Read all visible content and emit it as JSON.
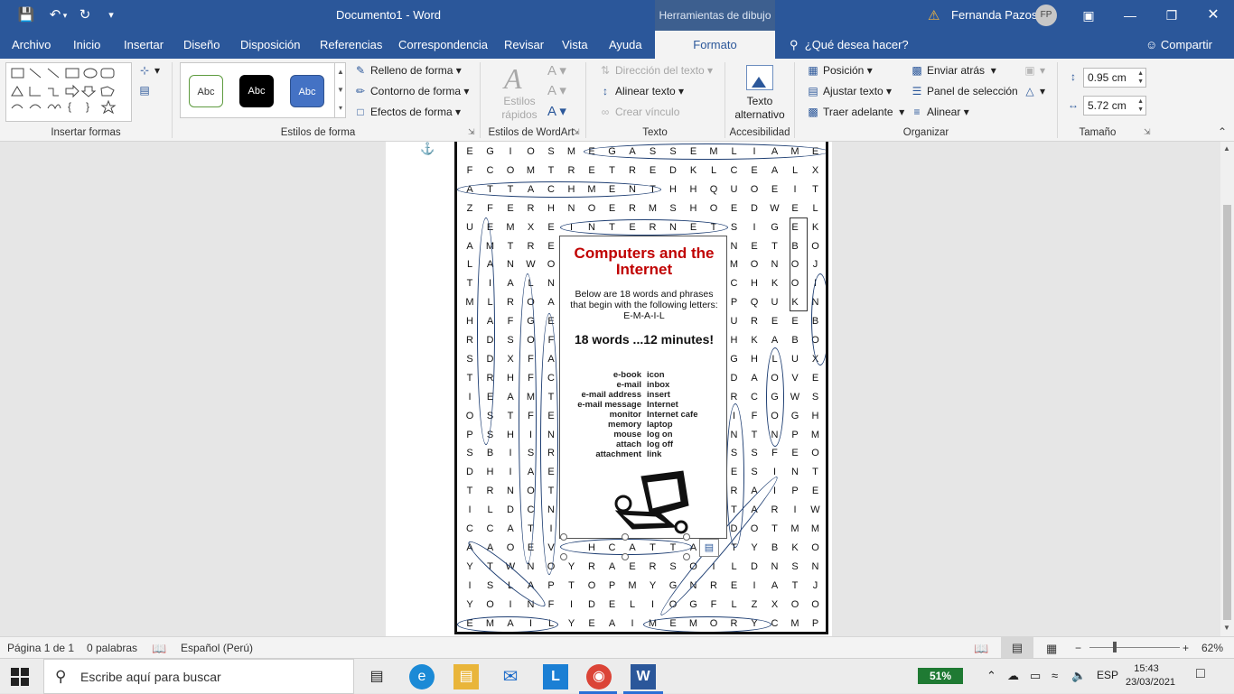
{
  "titlebar": {
    "doc_title": "Documento1  -  Word",
    "drawing_tools": "Herramientas de dibujo",
    "user_name": "Fernanda Pazos",
    "user_initials": "FP"
  },
  "tabs": [
    "Archivo",
    "Inicio",
    "Insertar",
    "Diseño",
    "Disposición",
    "Referencias",
    "Correspondencia",
    "Revisar",
    "Vista",
    "Ayuda",
    "Formato"
  ],
  "active_tab": "Formato",
  "help_search": "¿Qué desea hacer?",
  "share": "Compartir",
  "ribbon": {
    "insert_shapes": "Insertar formas",
    "shape_styles": "Estilos de forma",
    "style_abc": "Abc",
    "fill": "Relleno de forma",
    "outline": "Contorno de forma",
    "effects": "Efectos de forma",
    "wordart_styles": "Estilos de WordArt",
    "quick_styles": "Estilos rápidos",
    "text_direction": "Dirección del texto",
    "align_text": "Alinear texto",
    "create_link": "Crear vínculo",
    "text_group": "Texto",
    "alt_text": "Texto alternativo",
    "accessibility": "Accesibilidad",
    "position": "Posición",
    "wrap_text": "Ajustar texto",
    "bring_forward": "Traer adelante",
    "send_backward": "Enviar atrás",
    "selection_pane": "Panel de selección",
    "align": "Alinear",
    "arrange": "Organizar",
    "height": "0.95 cm",
    "width": "5.72 cm",
    "size": "Tamaño"
  },
  "puzzle": {
    "grid": [
      "EGIOSMEGASSEMLIAME",
      "FCOMTRETREDKLCEALX",
      "ATTACHMENTHHQUOEIT",
      "ZFERHNOERMSHOEDWEL",
      "UEMXEINTERNETSIGEK",
      "AMTRE      NETBO",
      "LANWO      MONOJ",
      "TIALN      CHKOI",
      "MLROA      PQUKN",
      "HAFGE      UREEB",
      "RDSOF      HKABO",
      "SDXFA      GHLUX",
      "TRHFC      DAOVE",
      "IEAMT      RCGWS",
      "OSTFE      IFOGH",
      "PSHIN      NTNPM",
      "SBISR      SSFEO",
      "DHIAE      ESINT",
      "TRNOT      RAIPE",
      "ILDCN      TARIW",
      "CCATI      DOTMM",
      "AAOEVHCATTAVTYBKO",
      "YTWNOYRAERSOILDNSN",
      "ISLAPTOPMYGNREIATJ",
      "YOINFIDELIOGFLZXOO",
      "EMAILYEAIMEMORYCMP"
    ],
    "title": "Computers and the Internet",
    "description": "Below are 18 words and phrases that begin with the following letters:  E-M-A-I-L",
    "count_text": "18 words ...12 minutes!",
    "words_left": [
      "e-book",
      "e-mail",
      "e-mail address",
      "e-mail message",
      "monitor",
      "memory",
      "mouse",
      "attach",
      "attachment"
    ],
    "words_right": [
      "icon",
      "inbox",
      "insert",
      "Internet",
      "Internet cafe",
      "laptop",
      "log on",
      "log off",
      "link"
    ]
  },
  "status": {
    "page": "Página 1 de 1",
    "words": "0 palabras",
    "language": "Español (Perú)",
    "zoom": "62%"
  },
  "taskbar": {
    "search_placeholder": "Escribe aquí para buscar",
    "battery": "51%",
    "lang": "ESP",
    "time": "15:43",
    "date": "23/03/2021"
  }
}
